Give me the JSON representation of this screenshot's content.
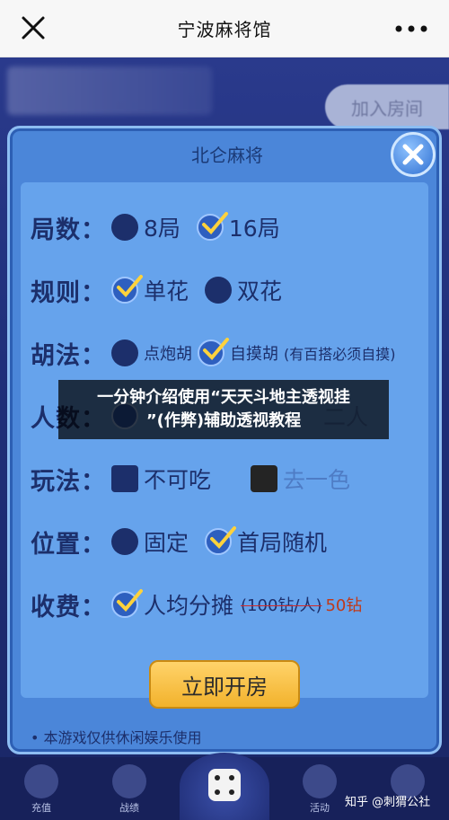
{
  "nav": {
    "title": "宁波麻将馆"
  },
  "background": {
    "join_button": "加入房间"
  },
  "dialog": {
    "title": "北仑麻将",
    "rows": {
      "rounds": {
        "label": "局数：",
        "opt1": "8局",
        "opt2": "16局"
      },
      "rules": {
        "label": "规则：",
        "opt1": "单花",
        "opt2": "双花"
      },
      "hu": {
        "label": "胡法：",
        "opt1": "点炮胡",
        "opt2": "自摸胡",
        "note": "(有百搭必须自摸)"
      },
      "players": {
        "label": "人数：",
        "opt2": "二人"
      },
      "play": {
        "label": "玩法：",
        "opt1": "不可吃",
        "opt2": "去一色"
      },
      "position": {
        "label": "位置：",
        "opt1": "固定",
        "opt2": "首局随机"
      },
      "fee": {
        "label": "收费：",
        "opt1": "人均分摊",
        "strike": "(100钻/人)",
        "price": "50钻"
      }
    },
    "confirm_button": "立即开房",
    "footer_note": "• 本游戏仅供休闲娱乐使用"
  },
  "banner": {
    "line1": "一分钟介绍使用“天天斗地主透视挂",
    "line2": "”(作弊)辅助透视教程"
  },
  "bottom_tabs": {
    "recharge": "充值",
    "record": "战绩",
    "activity": "活动"
  },
  "watermark": "知乎 @刺猬公社"
}
